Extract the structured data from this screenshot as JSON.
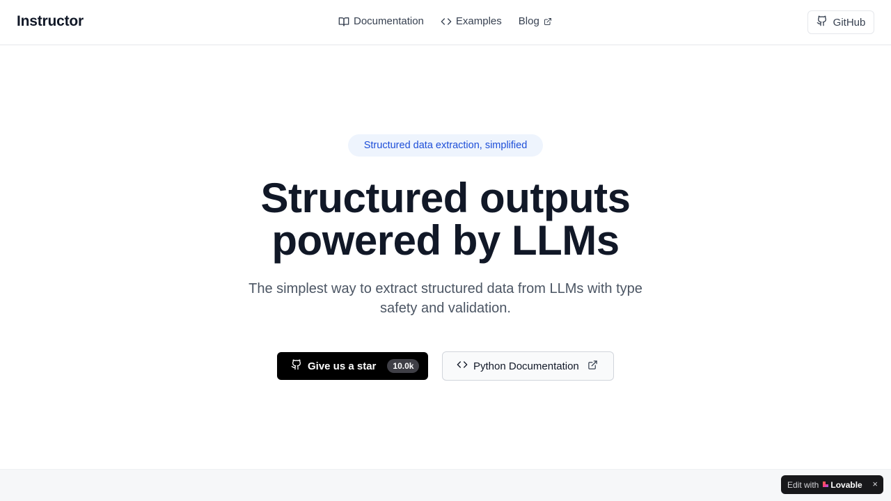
{
  "header": {
    "brand": "Instructor",
    "nav": [
      {
        "label": "Documentation",
        "icon": "book-icon"
      },
      {
        "label": "Examples",
        "icon": "code-icon"
      },
      {
        "label": "Blog",
        "icon": "external-link-icon"
      }
    ],
    "github_label": "GitHub"
  },
  "hero": {
    "badge": "Structured data extraction, simplified",
    "title_line1": "Structured outputs",
    "title_line2": "powered by LLMs",
    "subtitle_line1": "The simplest way to extract structured data from LLMs with type",
    "subtitle_line2": "safety and validation.",
    "star_button": {
      "label": "Give us a star",
      "count": "10.0k"
    },
    "docs_button": {
      "label": "Python Documentation"
    }
  },
  "lovable_badge": {
    "edit_label": "Edit with",
    "brand": "Lovable",
    "close": "×"
  },
  "colors": {
    "primary_button": "#000000",
    "badge_bg": "#eef4fd",
    "badge_text": "#1d4ed8",
    "text_dark": "#111827",
    "text_muted": "#4b5563"
  }
}
